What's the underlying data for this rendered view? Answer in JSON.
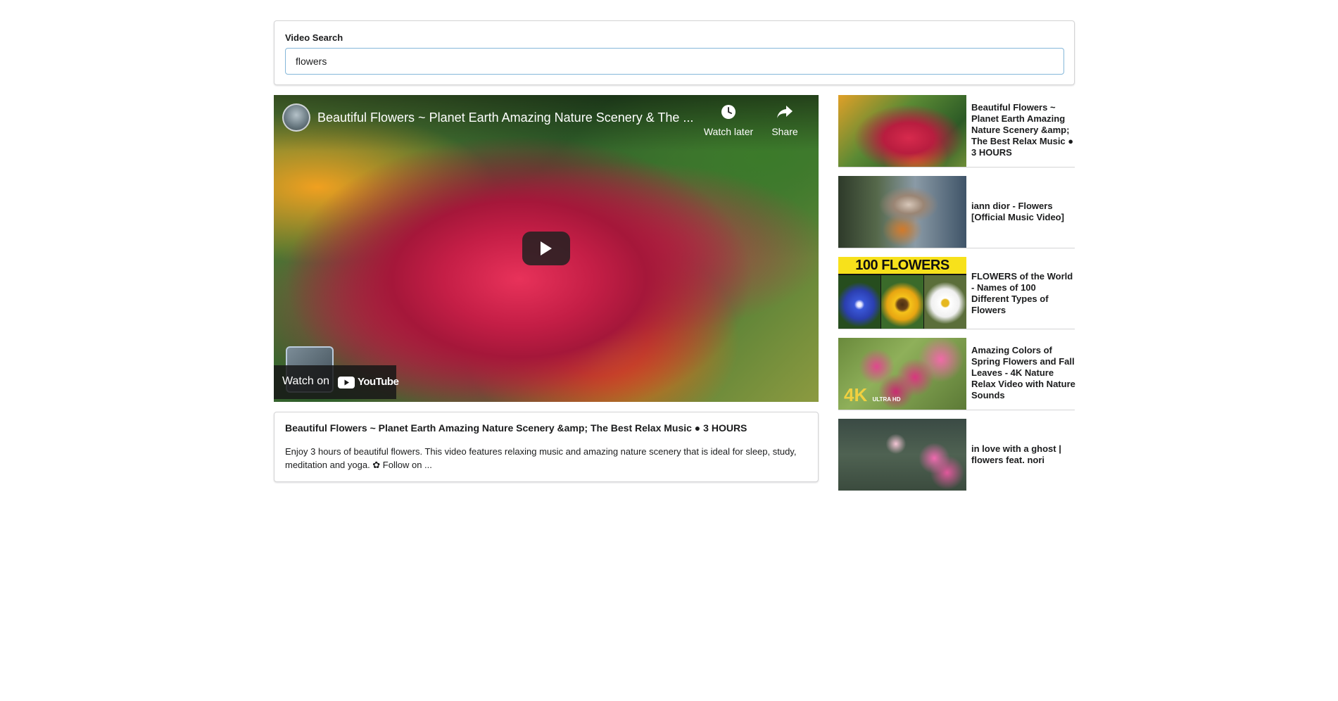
{
  "search": {
    "label": "Video Search",
    "value": "flowers",
    "placeholder": ""
  },
  "player": {
    "title": "Beautiful Flowers ~ Planet Earth Amazing Nature Scenery & The ...",
    "watch_later_label": "Watch later",
    "share_label": "Share",
    "watch_on_label": "Watch on",
    "youtube_label": "YouTube"
  },
  "selected_video": {
    "title": "Beautiful Flowers ~ Planet Earth Amazing Nature Scenery &amp; The Best Relax Music ● 3 HOURS",
    "description": "Enjoy 3 hours of beautiful flowers. This video features relaxing music and amazing nature scenery that is ideal for sleep, study, meditation and yoga. ✿ Follow on ..."
  },
  "video_list": [
    {
      "title": "Beautiful Flowers ~ Planet Earth Amazing Nature Scenery &amp; The Best Relax Music ● 3 HOURS"
    },
    {
      "title": "iann dior - Flowers [Official Music Video]"
    },
    {
      "title": "FLOWERS of the World - Names of 100 Different Types of Flowers",
      "thumb_banner": "100 FLOWERS"
    },
    {
      "title": "Amazing Colors of Spring Flowers and Fall Leaves - 4K Nature Relax Video with Nature Sounds",
      "thumb_badge": "4K",
      "thumb_badge_sub": "ULTRA HD"
    },
    {
      "title": "in love with a ghost | flowers feat. nori"
    }
  ]
}
